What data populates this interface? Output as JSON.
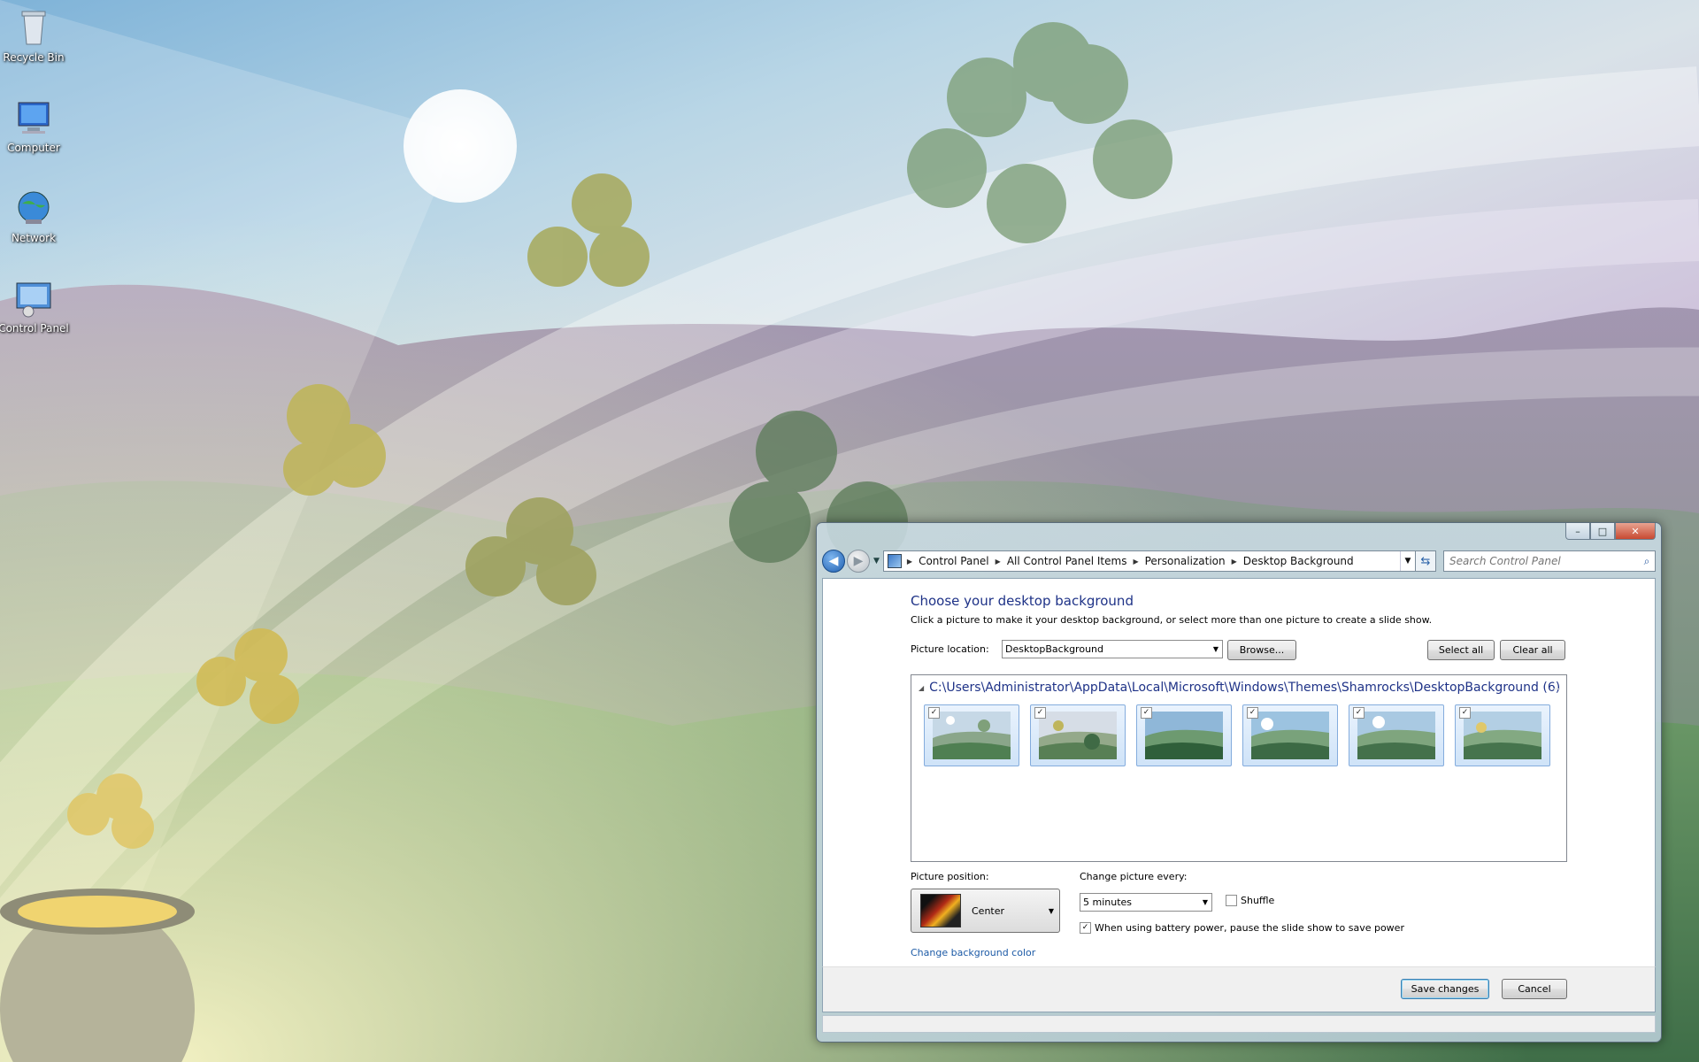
{
  "desktop": {
    "icons": [
      {
        "label": "Recycle Bin",
        "icon": "recycle-bin-icon"
      },
      {
        "label": "Computer",
        "icon": "computer-icon"
      },
      {
        "label": "Network",
        "icon": "network-icon"
      },
      {
        "label": "Control Panel",
        "icon": "control-panel-icon"
      }
    ]
  },
  "window": {
    "caption": {
      "minimize": "–",
      "maximize": "□",
      "close": "✕"
    },
    "address": {
      "crumbs": [
        "Control Panel",
        "All Control Panel Items",
        "Personalization",
        "Desktop Background"
      ]
    },
    "search": {
      "placeholder": "Search Control Panel"
    },
    "content": {
      "title": "Choose your desktop background",
      "subtitle": "Click a picture to make it your desktop background, or select more than one picture to create a slide show.",
      "picture_location_label": "Picture location:",
      "picture_location_value": "DesktopBackground",
      "browse": "Browse...",
      "select_all": "Select all",
      "clear_all": "Clear all",
      "group_header": "C:\\Users\\Administrator\\AppData\\Local\\Microsoft\\Windows\\Themes\\Shamrocks\\DesktopBackground (6)",
      "thumbnails": [
        {
          "checked": true
        },
        {
          "checked": true
        },
        {
          "checked": true
        },
        {
          "checked": true
        },
        {
          "checked": true
        },
        {
          "checked": true
        }
      ],
      "picture_position_label": "Picture position:",
      "picture_position_value": "Center",
      "change_every_label": "Change picture every:",
      "change_every_value": "5 minutes",
      "shuffle_label": "Shuffle",
      "shuffle_checked": false,
      "battery_label": "When using battery power, pause the slide show to save power",
      "battery_checked": true,
      "change_bg_color": "Change background color"
    },
    "footer": {
      "save": "Save changes",
      "cancel": "Cancel"
    }
  },
  "colors": {
    "title_blue": "#1e3287",
    "link_blue": "#1c5aa6"
  }
}
